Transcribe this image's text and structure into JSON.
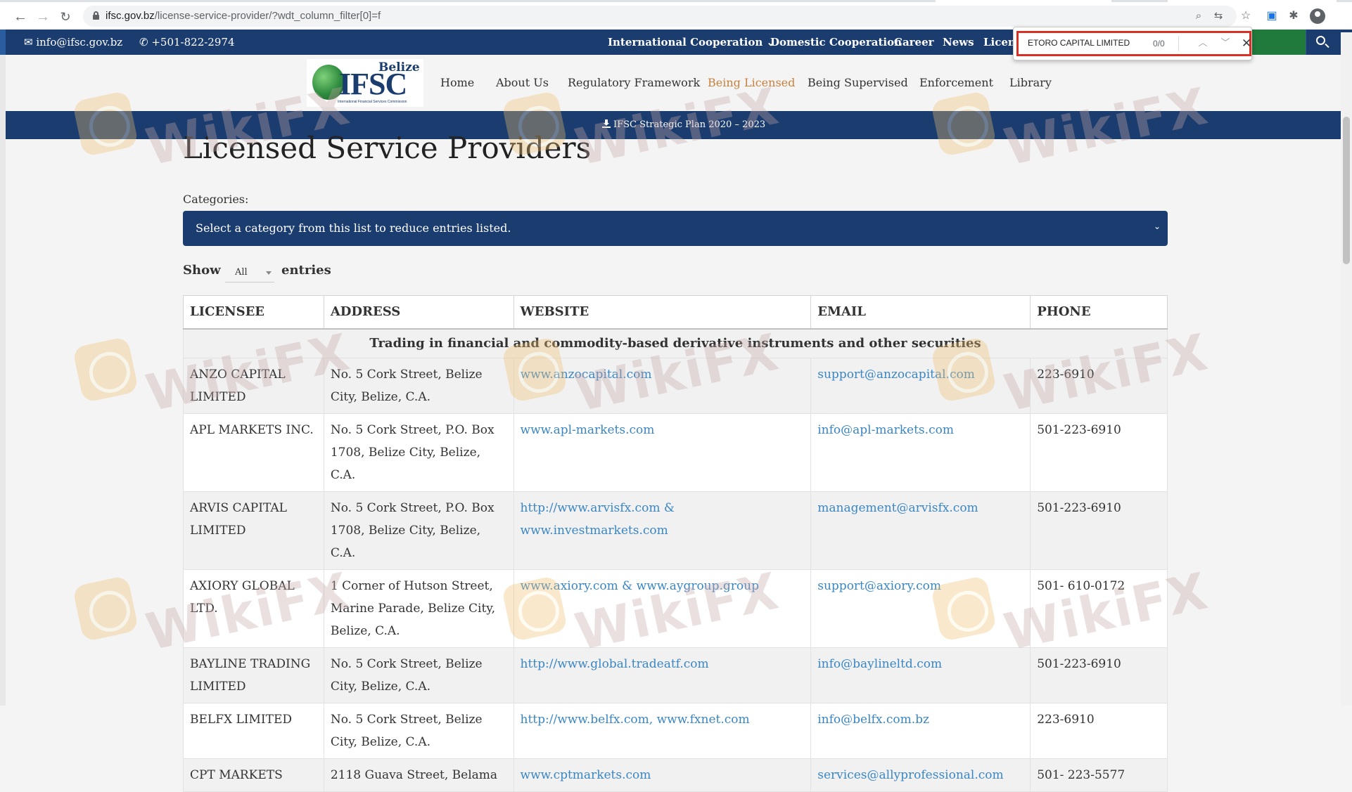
{
  "browser": {
    "url_host": "ifsc.gov.bz",
    "url_path": "/license-service-provider/?wdt_column_filter[0]=f"
  },
  "findbar": {
    "query": "ETORO CAPITAL LIMITED",
    "count": "0/0"
  },
  "topbar": {
    "email": "info@ifsc.gov.bz",
    "phone": "+501-822-2974",
    "nav": [
      "International Cooperation",
      "Domestic Cooperation",
      "Career",
      "News",
      "Licenc"
    ]
  },
  "logo": {
    "belize": "Belize",
    "ifsc": "IFSC",
    "tagline": "International Financial Services Commission"
  },
  "mainnav": [
    "Home",
    "About Us",
    "Regulatory Framework",
    "Being Licensed",
    "Being Supervised",
    "Enforcement",
    "Library"
  ],
  "strip": {
    "text": "IFSC Strategic Plan 2020 – 2023"
  },
  "page": {
    "title": "Licensed Service Providers",
    "categories_label": "Categories:",
    "categories_placeholder": "Select a category from this list to reduce entries listed.",
    "show_label": "Show",
    "show_value": "All",
    "entries_label": "entries"
  },
  "table": {
    "headers": [
      "LICENSEE",
      "ADDRESS",
      "WEBSITE",
      "EMAIL",
      "PHONE"
    ],
    "group": "Trading in financial and commodity-based derivative instruments and other securities",
    "rows": [
      {
        "licensee": "ANZO CAPITAL LIMITED",
        "address": "No. 5 Cork Street, Belize City, Belize, C.A.",
        "website": "www.anzocapital.com",
        "email": "support@anzocapital.com",
        "phone": "223-6910"
      },
      {
        "licensee": "APL MARKETS INC.",
        "address": "No. 5 Cork Street, P.O. Box 1708, Belize City, Belize, C.A.",
        "website": "www.apl-markets.com",
        "email": "info@apl-markets.com",
        "phone": "501-223-6910"
      },
      {
        "licensee": "ARVIS CAPITAL LIMITED",
        "address": "No. 5 Cork Street, P.O. Box 1708, Belize City, Belize, C.A.",
        "website": "http://www.arvisfx.com & www.investmarkets.com",
        "email": "management@arvisfx.com",
        "phone": "501-223-6910"
      },
      {
        "licensee": "AXIORY GLOBAL LTD.",
        "address": "1 Corner of Hutson Street, Marine Parade, Belize City, Belize, C.A.",
        "website": "www.axiory.com & www.aygroup.group",
        "email": "support@axiory.com",
        "phone": "501- 610-0172"
      },
      {
        "licensee": "BAYLINE TRADING LIMITED",
        "address": "No. 5 Cork Street, Belize City, Belize, C.A.",
        "website": "http://www.global.tradeatf.com",
        "email": "info@baylineltd.com",
        "phone": "501-223-6910"
      },
      {
        "licensee": "BELFX LIMITED",
        "address": "No. 5 Cork Street, Belize City, Belize, C.A.",
        "website": "http://www.belfx.com, www.fxnet.com",
        "email": "info@belfx.com.bz",
        "phone": "223-6910"
      },
      {
        "licensee": "CPT MARKETS",
        "address": "2118 Guava Street, Belama",
        "website": "www.cptmarkets.com",
        "email": "services@allyprofessional.com",
        "phone": "501- 223-5577"
      }
    ]
  },
  "watermark": "WikiFX",
  "colors": {
    "navy": "#1b3c6e",
    "active_nav": "#c8813a",
    "link": "#3a86c4",
    "green": "#1f7a3c"
  }
}
